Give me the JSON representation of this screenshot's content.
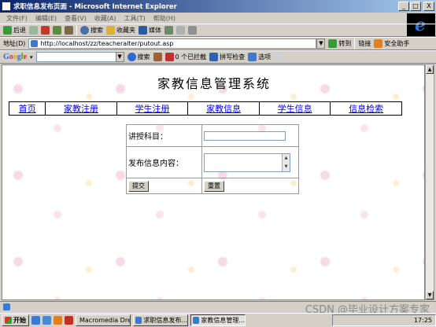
{
  "window": {
    "title": "求职信息发布页面 - Microsoft Internet Explorer",
    "min_label": "_",
    "max_label": "□",
    "close_label": "X"
  },
  "menu": [
    "文件(F)",
    "编辑(E)",
    "查看(V)",
    "收藏(A)",
    "工具(T)",
    "帮助(H)"
  ],
  "toolbar": {
    "back": "后退",
    "search": "搜索",
    "favorites": "收藏夹",
    "media": "媒体"
  },
  "address": {
    "label": "地址(D)",
    "url": "http://localhost/zz/teacheralter/putout.asp",
    "go": "转到",
    "links": "链接",
    "safety": "安全助手"
  },
  "google": {
    "logo": "Google",
    "search": "搜索",
    "blocked": "0 个已拦截",
    "spell": "拼写检查",
    "options": "选项"
  },
  "page": {
    "title": "家教信息管理系统",
    "nav": [
      "首页",
      "家教注册",
      "学生注册",
      "家教信息",
      "学生信息",
      "信息检索"
    ],
    "form": {
      "subject_label": "讲授科目：",
      "subject_value": "",
      "content_label": "发布信息内容：",
      "content_value": "",
      "submit": "提交",
      "reset": "重置"
    }
  },
  "watermark": "CSDN @毕业设计方案专家",
  "taskbar": {
    "start": "开始",
    "tasks": [
      "Macromedia Dre...",
      "求职信息发布...",
      "家教信息管理..."
    ],
    "clock": "17:25"
  }
}
